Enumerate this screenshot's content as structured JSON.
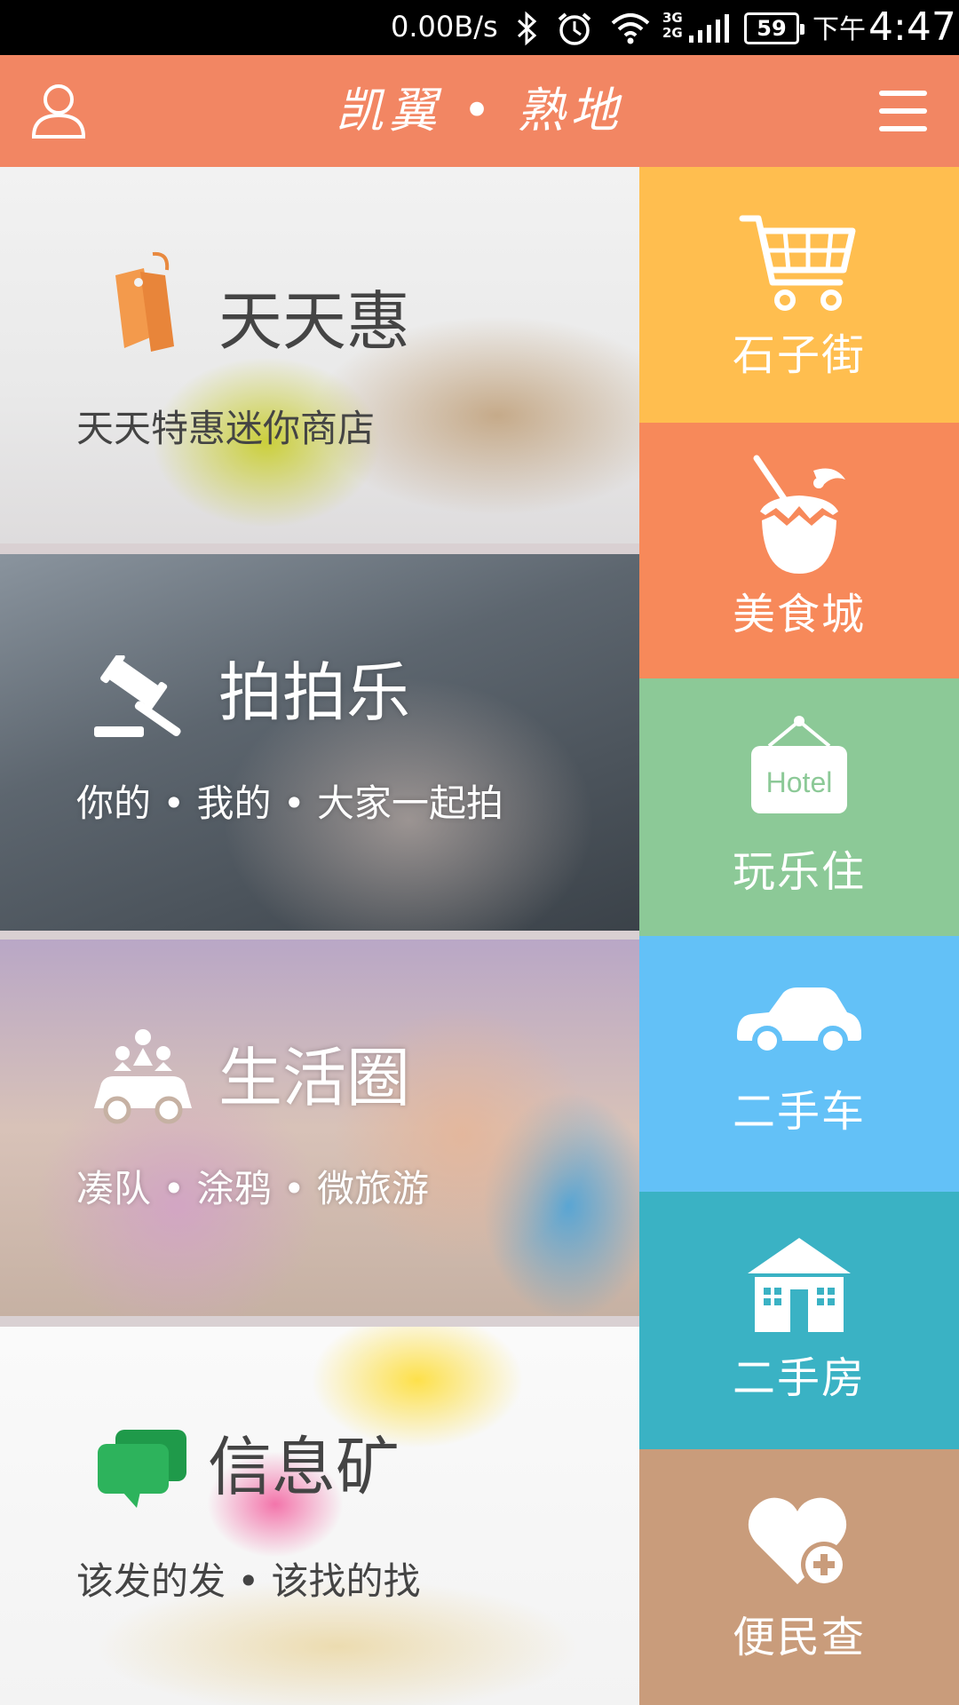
{
  "status_bar": {
    "speed": "0.00B/s",
    "signal_label": "3G\n2G",
    "battery": "59",
    "ampm": "下午",
    "time": "4:47"
  },
  "header": {
    "title": "凯翼 • 熟地",
    "user_icon": "user-icon",
    "menu_icon": "menu-icon"
  },
  "cards": [
    {
      "title": "天天惠",
      "subtitle": "天天特惠迷你商店",
      "icon": "price-tag-icon"
    },
    {
      "title": "拍拍乐",
      "subtitle": "你的 • 我的 • 大家一起拍",
      "icon": "gavel-icon"
    },
    {
      "title": "生活圈",
      "subtitle": "凑队 • 涂鸦 • 微旅游",
      "icon": "people-car-icon"
    },
    {
      "title": "信息矿",
      "subtitle": "该发的发 • 该找的找",
      "icon": "chat-bubbles-icon"
    }
  ],
  "tiles": [
    {
      "label": "石子街",
      "icon": "shopping-cart-icon",
      "color": "#ffbe4f"
    },
    {
      "label": "美食城",
      "icon": "coconut-drink-icon",
      "color": "#f7895a"
    },
    {
      "label": "玩乐住",
      "icon": "hotel-sign-icon",
      "color": "#8cc997",
      "icon_text": "Hotel"
    },
    {
      "label": "二手车",
      "icon": "car-icon",
      "color": "#63c1f7"
    },
    {
      "label": "二手房",
      "icon": "house-icon",
      "color": "#3ab2c4"
    },
    {
      "label": "便民查",
      "icon": "heart-plus-icon",
      "color": "#c99c7b"
    }
  ]
}
